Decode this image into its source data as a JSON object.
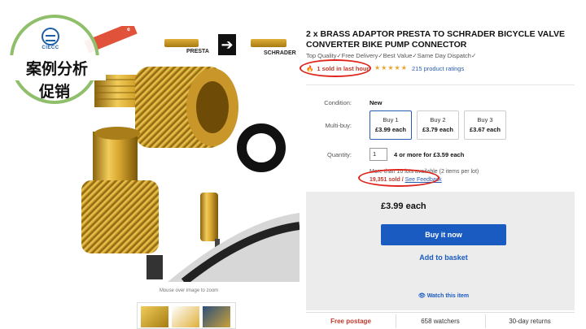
{
  "badge": {
    "logo_text": "CIECC",
    "line1": "案例分析",
    "line2": "促销"
  },
  "gallery": {
    "ribbon": "e",
    "label_presta": "PRESTA",
    "label_schrader": "SCHRADER",
    "zoom_hint": "Mouse over image to zoom"
  },
  "product": {
    "title": "2 x BRASS ADAPTOR PRESTA TO SCHRADER BICYCLE VALVE CONVERTER BIKE PUMP CONNECTOR",
    "tagline": "Top Quality✓Free Delivery✓Best Value✓Same Day Dispatch✓",
    "sold_last_hour": "1 sold in last hour",
    "stars": "★★★★★",
    "rating_value": 4.5,
    "ratings_text": "215 product ratings"
  },
  "condition": {
    "label": "Condition:",
    "value": "New"
  },
  "multibuy": {
    "label": "Multi-buy:",
    "options": [
      {
        "name": "Buy 1",
        "price": "£3.99 each"
      },
      {
        "name": "Buy 2",
        "price": "£3.79 each"
      },
      {
        "name": "Buy 3",
        "price": "£3.67 each"
      }
    ]
  },
  "quantity": {
    "label": "Quantity:",
    "value": "1",
    "note": "4 or more for £3.59 each",
    "lots": "More than 10 lots available (2 items per lot)",
    "sold": "19,351 sold",
    "feedback": "See Feedback"
  },
  "buybox": {
    "price": "£3.99 each",
    "buy_now": "Buy it now",
    "add_basket": "Add to basket",
    "watch": "Watch this item"
  },
  "footer": {
    "postage": "Free postage",
    "watchers": "658 watchers",
    "returns": "30-day returns"
  },
  "colors": {
    "accent": "#1a5bc1",
    "alert": "#e0241b",
    "badge_ring": "#8fbf6a"
  }
}
